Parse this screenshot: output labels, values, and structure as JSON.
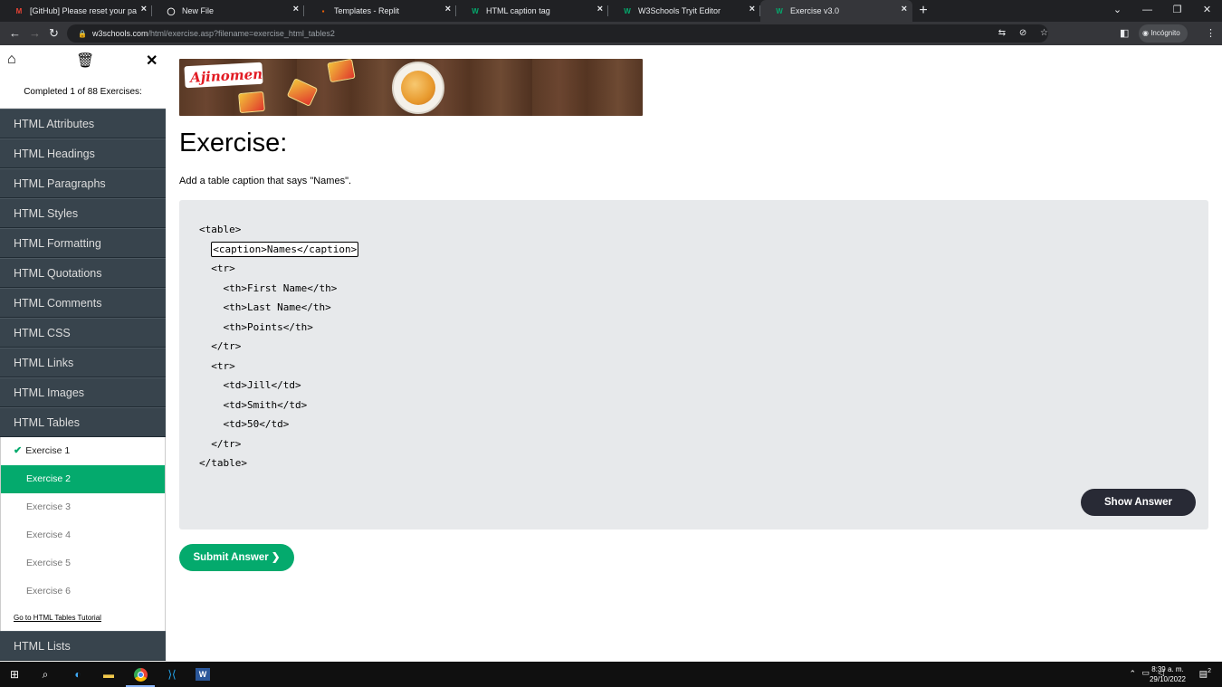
{
  "browser": {
    "tabs": [
      {
        "icon": "gmail-icon",
        "title": "[GitHub] Please reset your passw",
        "active": false
      },
      {
        "icon": "github-icon",
        "title": "New File",
        "active": false
      },
      {
        "icon": "replit-icon",
        "title": "Templates - Replit",
        "active": false
      },
      {
        "icon": "w3schools-icon",
        "title": "HTML caption tag",
        "active": false
      },
      {
        "icon": "w3schools-icon",
        "title": "W3Schools Tryit Editor",
        "active": false
      },
      {
        "icon": "w3schools-icon",
        "title": "Exercise v3.0",
        "active": true
      }
    ],
    "url_host": "w3schools.com",
    "url_path": "/html/exercise.asp?filename=exercise_html_tables2",
    "incognito_label": "Incógnito"
  },
  "sidebar": {
    "progress_text": "Completed 1 of 88 Exercises:",
    "categories_before": [
      "HTML Attributes",
      "HTML Headings",
      "HTML Paragraphs",
      "HTML Styles",
      "HTML Formatting",
      "HTML Quotations",
      "HTML Comments",
      "HTML CSS",
      "HTML Links",
      "HTML Images",
      "HTML Tables"
    ],
    "exercises": [
      {
        "label": "Exercise 1",
        "state": "done"
      },
      {
        "label": "Exercise 2",
        "state": "active"
      },
      {
        "label": "Exercise 3",
        "state": "todo"
      },
      {
        "label": "Exercise 4",
        "state": "todo"
      },
      {
        "label": "Exercise 5",
        "state": "todo"
      },
      {
        "label": "Exercise 6",
        "state": "todo"
      }
    ],
    "tutorial_link": "Go to HTML Tables Tutorial",
    "categories_after": [
      "HTML Lists"
    ]
  },
  "ad": {
    "brand": "Ajinomen"
  },
  "main": {
    "title": "Exercise:",
    "instruction": "Add a table caption that says \"Names\".",
    "code": {
      "line1": "<table>",
      "answer_value": "<caption>Names</caption>",
      "lines_after": [
        "  <tr>",
        "    <th>First Name</th>",
        "    <th>Last Name</th>",
        "    <th>Points</th>",
        "  </tr>",
        "  <tr>",
        "    <td>Jill</td>",
        "    <td>Smith</td>",
        "    <td>50</td>",
        "  </tr>",
        "</table>"
      ]
    },
    "show_answer_label": "Show Answer",
    "submit_label": "Submit Answer ❯"
  },
  "taskbar": {
    "time": "8:39 a. m.",
    "date": "29/10/2022",
    "notification_count": "2"
  },
  "colors": {
    "accent_green": "#04aa6d",
    "sidebar_dark": "#38444d",
    "button_dark": "#282a35",
    "code_bg": "#e7e9eb"
  }
}
